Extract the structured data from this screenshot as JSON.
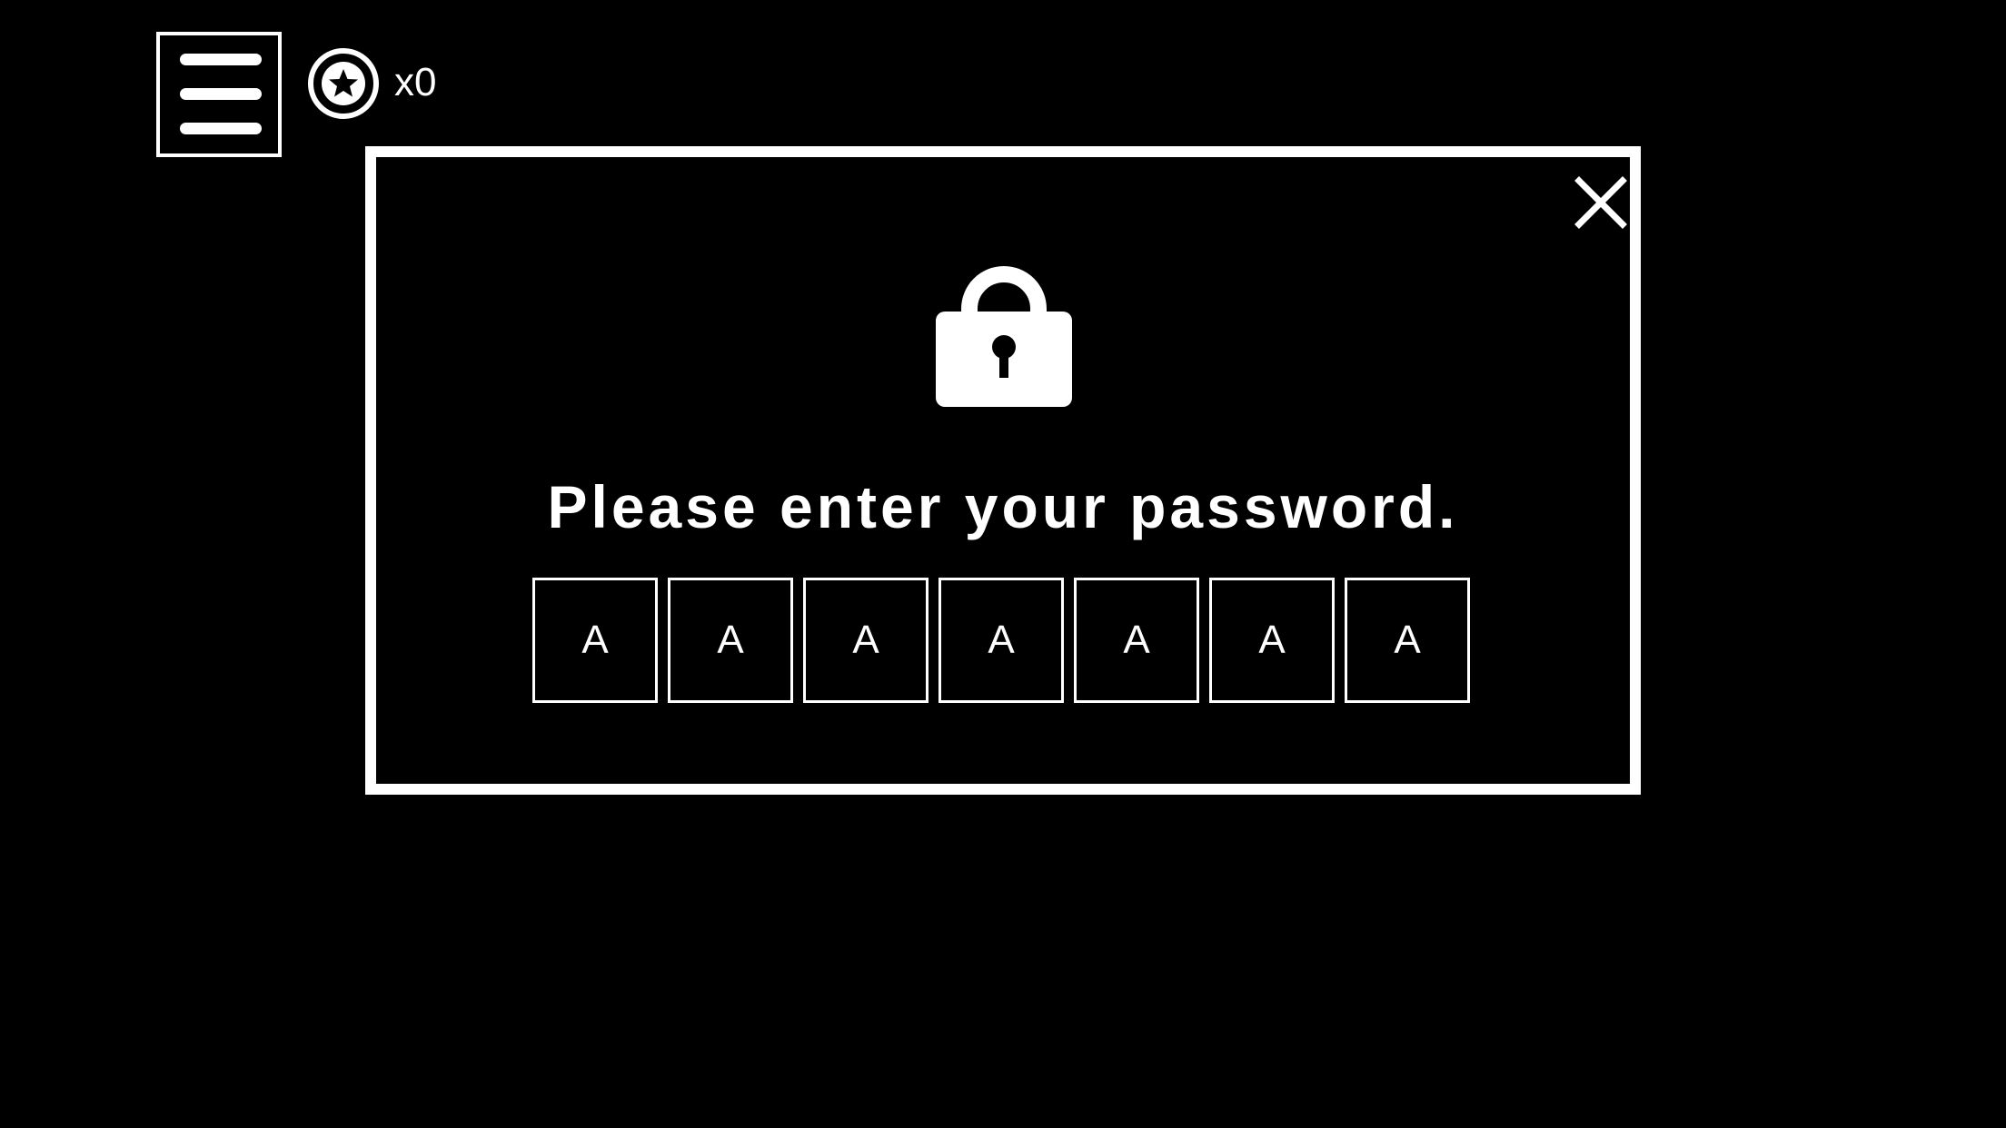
{
  "hud": {
    "menu_icon": "hamburger-menu-icon",
    "coin_icon": "star-coin-icon",
    "coin_count": "x0"
  },
  "dialog": {
    "lock_icon": "padlock-icon",
    "close_icon": "close-icon",
    "prompt": "Please enter your password.",
    "slots": [
      "A",
      "A",
      "A",
      "A",
      "A",
      "A",
      "A"
    ]
  },
  "colors": {
    "background": "#000000",
    "foreground": "#ffffff"
  }
}
